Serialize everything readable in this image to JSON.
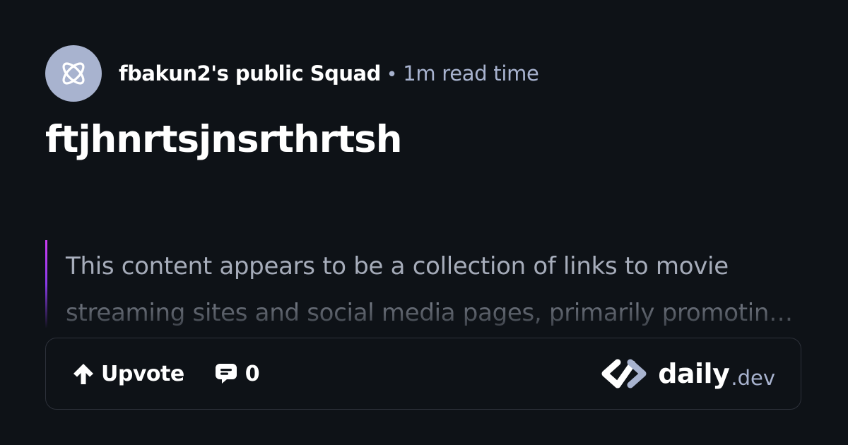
{
  "header": {
    "squad_name": "fbakun2's public Squad",
    "separator": "•",
    "read_time": "1m read time",
    "avatar_icon": "atom-icon"
  },
  "post": {
    "title": "ftjhnrtsjnsrthrtsh",
    "summary": "This content appears to be a collection of links to movie streaming sites and social media pages, primarily promoting free streaming content."
  },
  "actions": {
    "upvote_label": "Upvote",
    "upvote_icon": "arrow-up-icon",
    "comment_count": "0",
    "comment_icon": "comment-icon"
  },
  "brand": {
    "name": "daily",
    "suffix": ".dev",
    "logo_icon": "daily-dev-logo-icon"
  },
  "colors": {
    "background": "#0e1217",
    "avatar_bg": "#a8b3cf",
    "secondary_text": "#a8b3cf",
    "summary_accent_top": "#ce3df3",
    "summary_accent_bottom": "#8a3be8",
    "border": "#2d313a"
  }
}
